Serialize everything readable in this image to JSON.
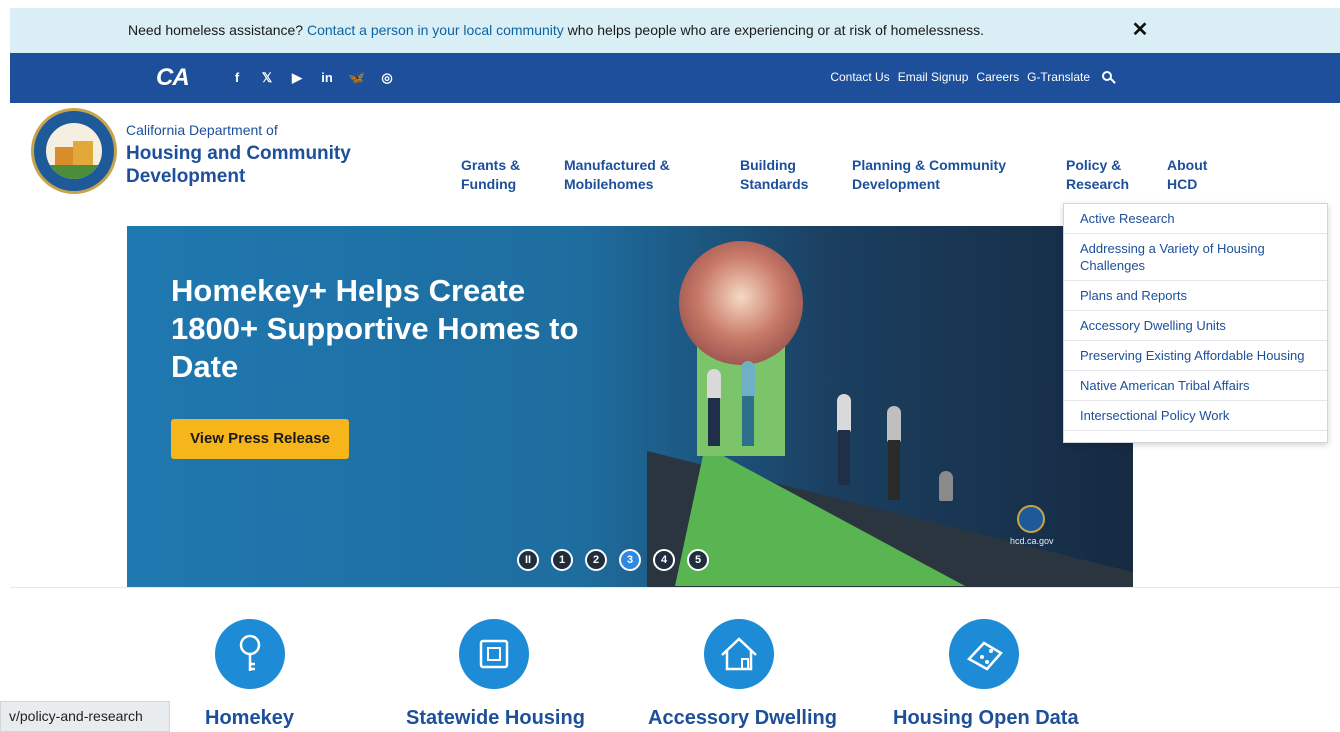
{
  "alert": {
    "prefix": "Need homeless assistance? ",
    "link": "Contact a person in your local community",
    "suffix": " who helps people who are experiencing or at risk of homelessness.",
    "close": "✕"
  },
  "utility": {
    "ca_logo": "CA",
    "social": [
      "f",
      "𝕏",
      "▶",
      "in",
      "🦋",
      "◎"
    ],
    "links": [
      "Contact Us",
      "Email Signup",
      "Careers",
      "G-Translate"
    ]
  },
  "header": {
    "dept_prefix": "California Department of",
    "dept_name": "Housing and Community Development"
  },
  "nav": [
    {
      "line1": "Grants &",
      "line2": "Funding"
    },
    {
      "line1": "Manufactured &",
      "line2": "Mobilehomes"
    },
    {
      "line1": "Building",
      "line2": "Standards"
    },
    {
      "line1": "Planning & Community",
      "line2": "Development"
    },
    {
      "line1": "Policy &",
      "line2": "Research"
    },
    {
      "line1": "About",
      "line2": "HCD"
    }
  ],
  "dropdown": [
    "Active Research",
    "Addressing a Variety of Housing Challenges",
    "Plans and Reports",
    "Accessory Dwelling Units",
    "Preserving Existing Affordable Housing",
    "Native American Tribal Affairs",
    "Intersectional Policy Work"
  ],
  "hero": {
    "title": "Homekey+ Helps Create 1800+ Supportive Homes to Date",
    "button": "View Press Release",
    "site": "hcd.ca.gov",
    "slides": [
      "II",
      "1",
      "2",
      "3",
      "4",
      "5"
    ],
    "active_slide": "3"
  },
  "features": [
    {
      "label": "Homekey",
      "icon": "key-icon"
    },
    {
      "label": "Statewide Housing",
      "icon": "blueprint-icon"
    },
    {
      "label": "Accessory Dwelling",
      "icon": "house-icon"
    },
    {
      "label": "Housing Open Data",
      "icon": "map-icon"
    }
  ],
  "status_url": "v/policy-and-research"
}
